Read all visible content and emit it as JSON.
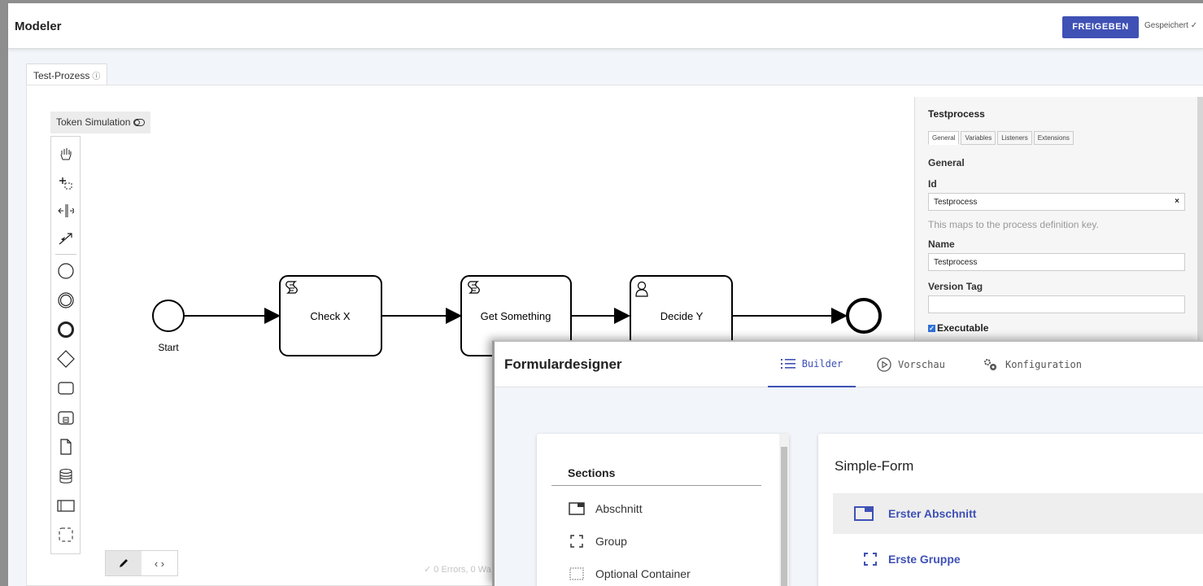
{
  "modeler": {
    "title": "Modeler",
    "release_label": "FREIGEBEN",
    "saved_status": "Gespeichert ✓",
    "tab_label": "Test-Prozess",
    "tab_info_icon": "info-icon",
    "token_simulation_label": "Token Simulation",
    "palette_tools": [
      "hand-tool-icon",
      "lasso-tool-icon",
      "space-tool-icon",
      "global-connect-icon",
      "start-event-icon",
      "intermediate-event-icon",
      "end-event-icon",
      "gateway-icon",
      "task-icon",
      "subprocess-icon",
      "data-object-icon",
      "data-store-icon",
      "pool-icon",
      "group-icon"
    ],
    "lint_status": "✓ 0 Errors, 0 Wa"
  },
  "diagram": {
    "start_label": "Start",
    "tasks": [
      {
        "label": "Check X",
        "type": "script-task"
      },
      {
        "label": "Get Something",
        "type": "script-task"
      },
      {
        "label": "Decide Y",
        "type": "user-task"
      }
    ]
  },
  "properties": {
    "title": "Testprocess",
    "tabs": [
      "General",
      "Variables",
      "Listeners",
      "Extensions"
    ],
    "active_tab": "General",
    "section_heading": "General",
    "id_label": "Id",
    "id_value": "Testprocess",
    "id_clear": "×",
    "id_hint": "This maps to the process definition key.",
    "name_label": "Name",
    "name_value": "Testprocess",
    "version_label": "Version Tag",
    "version_value": "",
    "executable_label": "Executable",
    "executable_checked": true
  },
  "formdesigner": {
    "title": "Formulardesigner",
    "tabs": [
      {
        "label": "Builder",
        "icon": "list-icon",
        "active": true
      },
      {
        "label": "Vorschau",
        "icon": "play-circle-icon",
        "active": false
      },
      {
        "label": "Konfiguration",
        "icon": "gears-icon",
        "active": false
      }
    ],
    "sections_heading": "Sections",
    "section_items": [
      {
        "label": "Abschnitt",
        "icon": "section-icon"
      },
      {
        "label": "Group",
        "icon": "group-brackets-icon"
      },
      {
        "label": "Optional Container",
        "icon": "dotted-container-icon"
      }
    ],
    "form_title": "Simple-Form",
    "form_items": [
      {
        "label": "Erster Abschnitt",
        "icon": "section-icon"
      },
      {
        "label": "Erste Gruppe",
        "icon": "group-brackets-icon"
      }
    ],
    "accent_color": "#3f51b5"
  }
}
